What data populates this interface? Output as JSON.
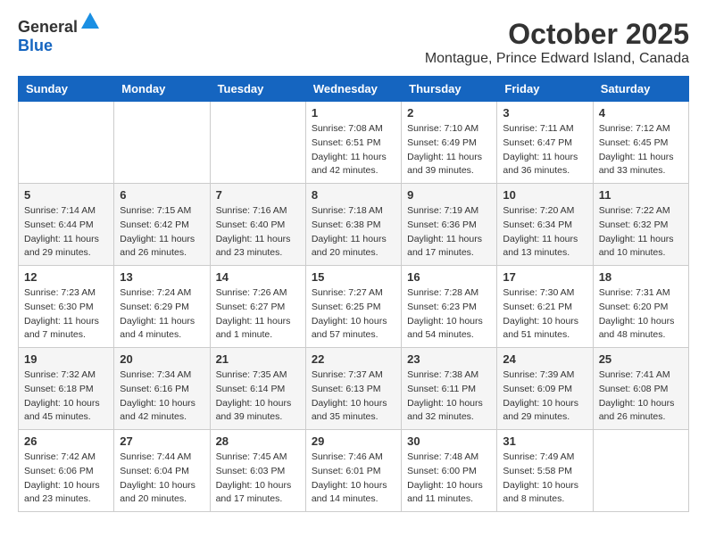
{
  "header": {
    "logo_general": "General",
    "logo_blue": "Blue",
    "month": "October 2025",
    "location": "Montague, Prince Edward Island, Canada"
  },
  "weekdays": [
    "Sunday",
    "Monday",
    "Tuesday",
    "Wednesday",
    "Thursday",
    "Friday",
    "Saturday"
  ],
  "weeks": [
    [
      {
        "day": "",
        "info": ""
      },
      {
        "day": "",
        "info": ""
      },
      {
        "day": "",
        "info": ""
      },
      {
        "day": "1",
        "info": "Sunrise: 7:08 AM\nSunset: 6:51 PM\nDaylight: 11 hours\nand 42 minutes."
      },
      {
        "day": "2",
        "info": "Sunrise: 7:10 AM\nSunset: 6:49 PM\nDaylight: 11 hours\nand 39 minutes."
      },
      {
        "day": "3",
        "info": "Sunrise: 7:11 AM\nSunset: 6:47 PM\nDaylight: 11 hours\nand 36 minutes."
      },
      {
        "day": "4",
        "info": "Sunrise: 7:12 AM\nSunset: 6:45 PM\nDaylight: 11 hours\nand 33 minutes."
      }
    ],
    [
      {
        "day": "5",
        "info": "Sunrise: 7:14 AM\nSunset: 6:44 PM\nDaylight: 11 hours\nand 29 minutes."
      },
      {
        "day": "6",
        "info": "Sunrise: 7:15 AM\nSunset: 6:42 PM\nDaylight: 11 hours\nand 26 minutes."
      },
      {
        "day": "7",
        "info": "Sunrise: 7:16 AM\nSunset: 6:40 PM\nDaylight: 11 hours\nand 23 minutes."
      },
      {
        "day": "8",
        "info": "Sunrise: 7:18 AM\nSunset: 6:38 PM\nDaylight: 11 hours\nand 20 minutes."
      },
      {
        "day": "9",
        "info": "Sunrise: 7:19 AM\nSunset: 6:36 PM\nDaylight: 11 hours\nand 17 minutes."
      },
      {
        "day": "10",
        "info": "Sunrise: 7:20 AM\nSunset: 6:34 PM\nDaylight: 11 hours\nand 13 minutes."
      },
      {
        "day": "11",
        "info": "Sunrise: 7:22 AM\nSunset: 6:32 PM\nDaylight: 11 hours\nand 10 minutes."
      }
    ],
    [
      {
        "day": "12",
        "info": "Sunrise: 7:23 AM\nSunset: 6:30 PM\nDaylight: 11 hours\nand 7 minutes."
      },
      {
        "day": "13",
        "info": "Sunrise: 7:24 AM\nSunset: 6:29 PM\nDaylight: 11 hours\nand 4 minutes."
      },
      {
        "day": "14",
        "info": "Sunrise: 7:26 AM\nSunset: 6:27 PM\nDaylight: 11 hours\nand 1 minute."
      },
      {
        "day": "15",
        "info": "Sunrise: 7:27 AM\nSunset: 6:25 PM\nDaylight: 10 hours\nand 57 minutes."
      },
      {
        "day": "16",
        "info": "Sunrise: 7:28 AM\nSunset: 6:23 PM\nDaylight: 10 hours\nand 54 minutes."
      },
      {
        "day": "17",
        "info": "Sunrise: 7:30 AM\nSunset: 6:21 PM\nDaylight: 10 hours\nand 51 minutes."
      },
      {
        "day": "18",
        "info": "Sunrise: 7:31 AM\nSunset: 6:20 PM\nDaylight: 10 hours\nand 48 minutes."
      }
    ],
    [
      {
        "day": "19",
        "info": "Sunrise: 7:32 AM\nSunset: 6:18 PM\nDaylight: 10 hours\nand 45 minutes."
      },
      {
        "day": "20",
        "info": "Sunrise: 7:34 AM\nSunset: 6:16 PM\nDaylight: 10 hours\nand 42 minutes."
      },
      {
        "day": "21",
        "info": "Sunrise: 7:35 AM\nSunset: 6:14 PM\nDaylight: 10 hours\nand 39 minutes."
      },
      {
        "day": "22",
        "info": "Sunrise: 7:37 AM\nSunset: 6:13 PM\nDaylight: 10 hours\nand 35 minutes."
      },
      {
        "day": "23",
        "info": "Sunrise: 7:38 AM\nSunset: 6:11 PM\nDaylight: 10 hours\nand 32 minutes."
      },
      {
        "day": "24",
        "info": "Sunrise: 7:39 AM\nSunset: 6:09 PM\nDaylight: 10 hours\nand 29 minutes."
      },
      {
        "day": "25",
        "info": "Sunrise: 7:41 AM\nSunset: 6:08 PM\nDaylight: 10 hours\nand 26 minutes."
      }
    ],
    [
      {
        "day": "26",
        "info": "Sunrise: 7:42 AM\nSunset: 6:06 PM\nDaylight: 10 hours\nand 23 minutes."
      },
      {
        "day": "27",
        "info": "Sunrise: 7:44 AM\nSunset: 6:04 PM\nDaylight: 10 hours\nand 20 minutes."
      },
      {
        "day": "28",
        "info": "Sunrise: 7:45 AM\nSunset: 6:03 PM\nDaylight: 10 hours\nand 17 minutes."
      },
      {
        "day": "29",
        "info": "Sunrise: 7:46 AM\nSunset: 6:01 PM\nDaylight: 10 hours\nand 14 minutes."
      },
      {
        "day": "30",
        "info": "Sunrise: 7:48 AM\nSunset: 6:00 PM\nDaylight: 10 hours\nand 11 minutes."
      },
      {
        "day": "31",
        "info": "Sunrise: 7:49 AM\nSunset: 5:58 PM\nDaylight: 10 hours\nand 8 minutes."
      },
      {
        "day": "",
        "info": ""
      }
    ]
  ]
}
